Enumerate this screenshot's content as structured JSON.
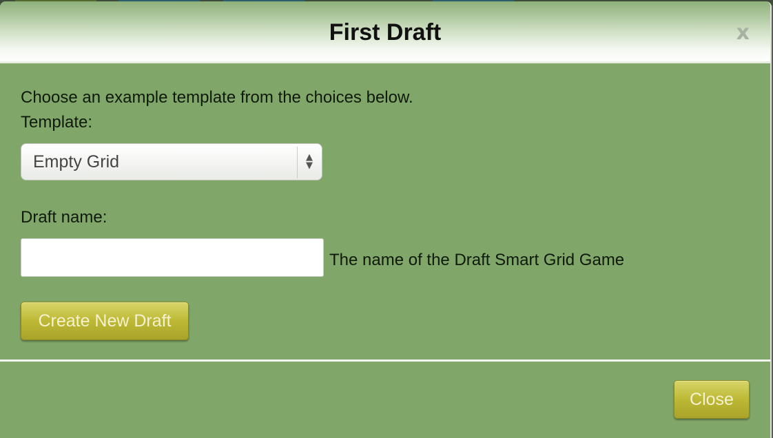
{
  "dialog": {
    "title": "First Draft",
    "close_glyph": "x",
    "intro": "Choose an example template from the choices below.",
    "template_label": "Template:",
    "template_selected": "Empty Grid",
    "draft_name_label": "Draft name:",
    "draft_name_value": "",
    "draft_name_hint": "The name of the Draft Smart Grid Game",
    "create_button": "Create New Draft",
    "close_button": "Close"
  },
  "icons": {
    "select_arrows": "up-down-arrows-icon",
    "close": "close-icon"
  },
  "colors": {
    "modal_background": "#81a669",
    "button_gold": "#bdb935",
    "header_white": "#ffffff"
  }
}
